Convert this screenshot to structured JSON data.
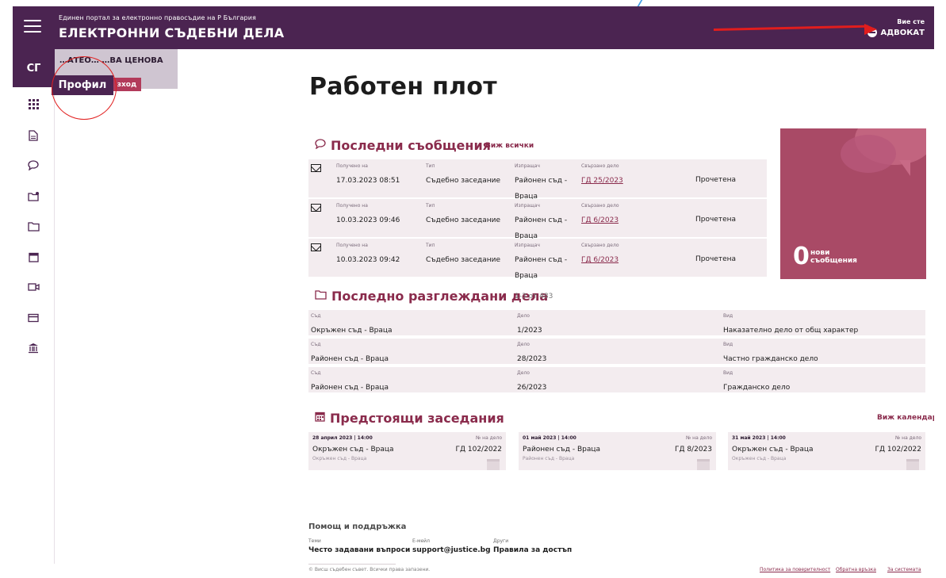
{
  "header": {
    "portal_line": "Единен портал за електронно правосъдие на Р България",
    "system_title": "ЕЛЕКТРОННИ СЪДЕБНИ ДЕЛА",
    "user_role_label": "Вие сте",
    "user_role": "АДВОКАТ",
    "accent_color": "#4b2451"
  },
  "sidebar": {
    "avatar_initials": "СГ",
    "icons": [
      "apps-icon",
      "document-icon",
      "message-icon",
      "folder-badge-icon",
      "folder-icon",
      "calendar-icon",
      "video-icon",
      "card-icon",
      "court-building-icon"
    ]
  },
  "profile_menu": {
    "name": "…АТЕО… …ВА ЦЕНОВА",
    "profile_label": "Профил",
    "exit_label": "зход"
  },
  "main": {
    "page_title": "Работен плот"
  },
  "messages": {
    "title": "Последни съобщения",
    "see_all": "Виж всички",
    "labels": {
      "received": "Получено на",
      "type": "Тип",
      "sender": "Изпращач",
      "linked_case": "Свързано дело"
    },
    "rows": [
      {
        "received": "17.03.2023 08:51",
        "type": "Съдебно заседание",
        "sender": "Районен съд - Враца",
        "case": "ГД 25/2023",
        "status": "Прочетена"
      },
      {
        "received": "10.03.2023 09:46",
        "type": "Съдебно заседание",
        "sender": "Районен съд - Враца",
        "case": "ГД 6/2023",
        "status": "Прочетена"
      },
      {
        "received": "10.03.2023 09:42",
        "type": "Съдебно заседание",
        "sender": "Районен съд - Враца",
        "case": "ГД 6/2023",
        "status": "Прочетена"
      }
    ],
    "new_count": "0",
    "new_label_1": "нови",
    "new_label_2": "съобщения",
    "card_color": "#a94a66"
  },
  "cases": {
    "title": "Последно разглеждани дела",
    "count": "1-3 от 483",
    "labels": {
      "court": "Съд",
      "case": "Дело",
      "kind": "Вид"
    },
    "rows": [
      {
        "court": "Окръжен съд - Враца",
        "case": "1/2023",
        "kind": "Наказателно дело от общ характер"
      },
      {
        "court": "Районен съд - Враца",
        "case": "28/2023",
        "kind": "Частно гражданско дело"
      },
      {
        "court": "Районен съд - Враца",
        "case": "26/2023",
        "kind": "Гражданско дело"
      }
    ]
  },
  "hearings": {
    "title": "Предстоящи заседания",
    "see_calendar": "Виж календар",
    "no_label": "№ на дело",
    "cards": [
      {
        "date": "28 април 2023 | 14:00",
        "court": "Окръжен съд - Враца",
        "case": "ГД 102/2022",
        "sub": "Окръжен съд - Враца"
      },
      {
        "date": "01 май 2023 | 14:00",
        "court": "Районен съд - Враца",
        "case": "ГД 8/2023",
        "sub": "Районен съд - Враца"
      },
      {
        "date": "31 май 2023 | 14:00",
        "court": "Окръжен съд - Враца",
        "case": "ГД 102/2022",
        "sub": "Окръжен съд - Враца"
      }
    ]
  },
  "footer": {
    "help_title": "Помощ и поддръжка",
    "topics_label": "Теми",
    "topics_value": "Често задавани въпроси",
    "email_label": "Е-мейл",
    "email_value": "support@justice.bg",
    "other_label": "Други",
    "other_value": "Правила за достъп",
    "copyright": "© Висш съдебен съвет. Всички права запазени.",
    "links": [
      "Политика за поверителност",
      "Обратна връзка",
      "За системата"
    ]
  }
}
